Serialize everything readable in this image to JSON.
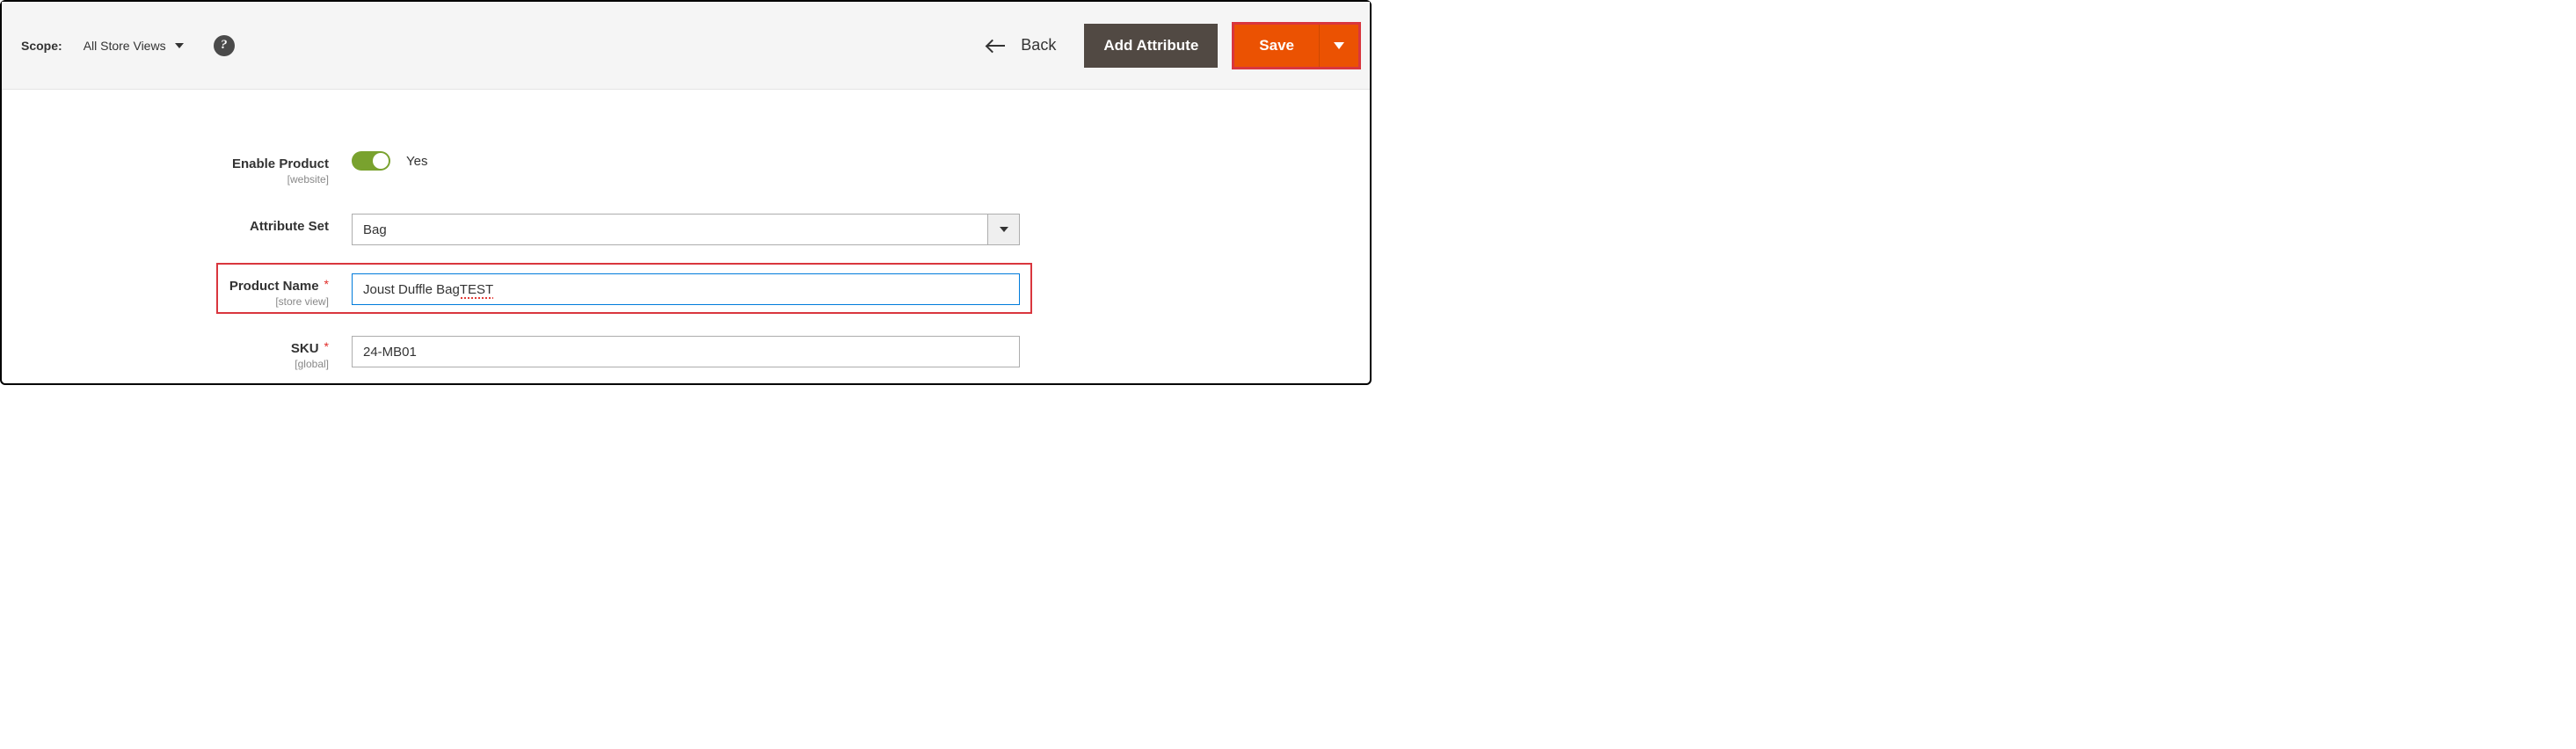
{
  "header": {
    "scope_label": "Scope:",
    "scope_value": "All Store Views",
    "help_glyph": "?",
    "back_label": "Back",
    "add_attribute_label": "Add Attribute",
    "save_label": "Save"
  },
  "form": {
    "enable_product": {
      "label": "Enable Product",
      "sub": "[website]",
      "value_label": "Yes",
      "value": true
    },
    "attribute_set": {
      "label": "Attribute Set",
      "value": "Bag"
    },
    "product_name": {
      "label": "Product Name",
      "sub": "[store view]",
      "required": true,
      "value_prefix": "Joust Duffle Bag ",
      "value_suffix": "TEST",
      "value": "Joust Duffle Bag TEST"
    },
    "sku": {
      "label": "SKU",
      "sub": "[global]",
      "required": true,
      "value": "24-MB01"
    }
  }
}
